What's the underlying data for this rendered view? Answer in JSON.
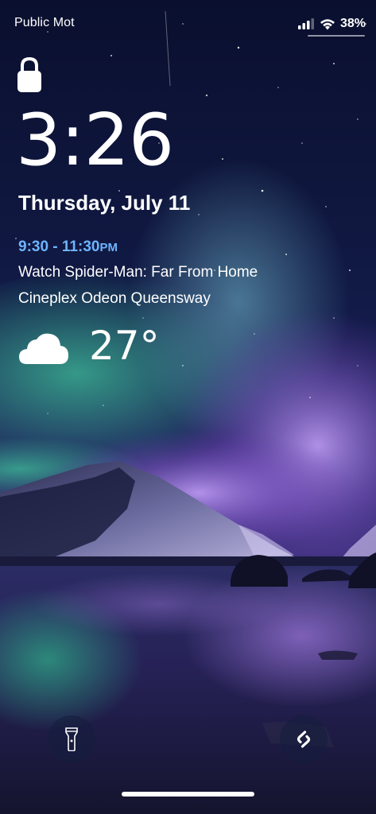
{
  "status_bar": {
    "carrier": "Public Mot",
    "battery_percent": "38%",
    "icons": [
      "cellular-signal-icon",
      "wifi-icon"
    ]
  },
  "lock_screen": {
    "lock_icon": "lock-icon",
    "time": "3:26",
    "date": "Thursday, July 11",
    "event": {
      "time_range": "9:30 - 11:30",
      "time_suffix": "PM",
      "title": "Watch Spider-Man: Far From Home",
      "location": "Cineplex Odeon Queensway"
    },
    "weather": {
      "icon": "cloud-icon",
      "temperature": "27°"
    }
  },
  "controls": {
    "left": "flashlight-icon",
    "right": "shazam-icon"
  },
  "colors": {
    "event_time": "#6db4ff",
    "sky_top": "#0b1030",
    "aurora_green": "#3fc29a",
    "aurora_purple": "#9a6fd6"
  }
}
